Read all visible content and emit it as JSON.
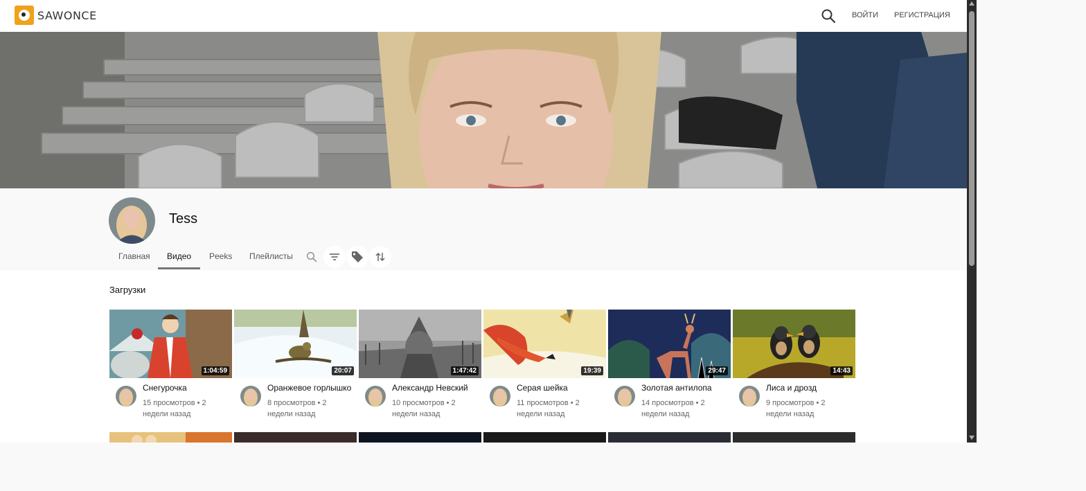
{
  "header": {
    "logo_text": "SAWONCE",
    "login_label": "ВОЙТИ",
    "register_label": "РЕГИСТРАЦИЯ"
  },
  "channel": {
    "name": "Tess",
    "tabs": [
      {
        "label": "Главная"
      },
      {
        "label": "Видео"
      },
      {
        "label": "Peeks"
      },
      {
        "label": "Плейлисты"
      }
    ],
    "active_tab": "Видео"
  },
  "section": {
    "title": "Загрузки"
  },
  "videos": [
    {
      "title": "Снегурочка",
      "duration": "1:04:59",
      "meta": "15 просмотров • 2 недели назад"
    },
    {
      "title": "Оранжевое горлышко",
      "duration": "20:07",
      "meta": "8 просмотров • 2 недели назад"
    },
    {
      "title": "Александр Невский",
      "duration": "1:47:42",
      "meta": "10 просмотров • 2 недели назад"
    },
    {
      "title": "Серая шейка",
      "duration": "19:39",
      "meta": "11 просмотров • 2 недели назад"
    },
    {
      "title": "Золотая антилопа",
      "duration": "29:47",
      "meta": "14 просмотров • 2 недели назад"
    },
    {
      "title": "Лиса и дрозд",
      "duration": "14:43",
      "meta": "9 просмотров • 2 недели назад"
    }
  ],
  "colors": {
    "accent": "#f0a21b",
    "text_primary": "#111111",
    "text_secondary": "#666666",
    "scrollbar": "#2b2b2b"
  },
  "icons": {
    "search": "search-icon",
    "filter": "filter-icon",
    "tag": "tag-icon",
    "sort": "sort-icon"
  }
}
